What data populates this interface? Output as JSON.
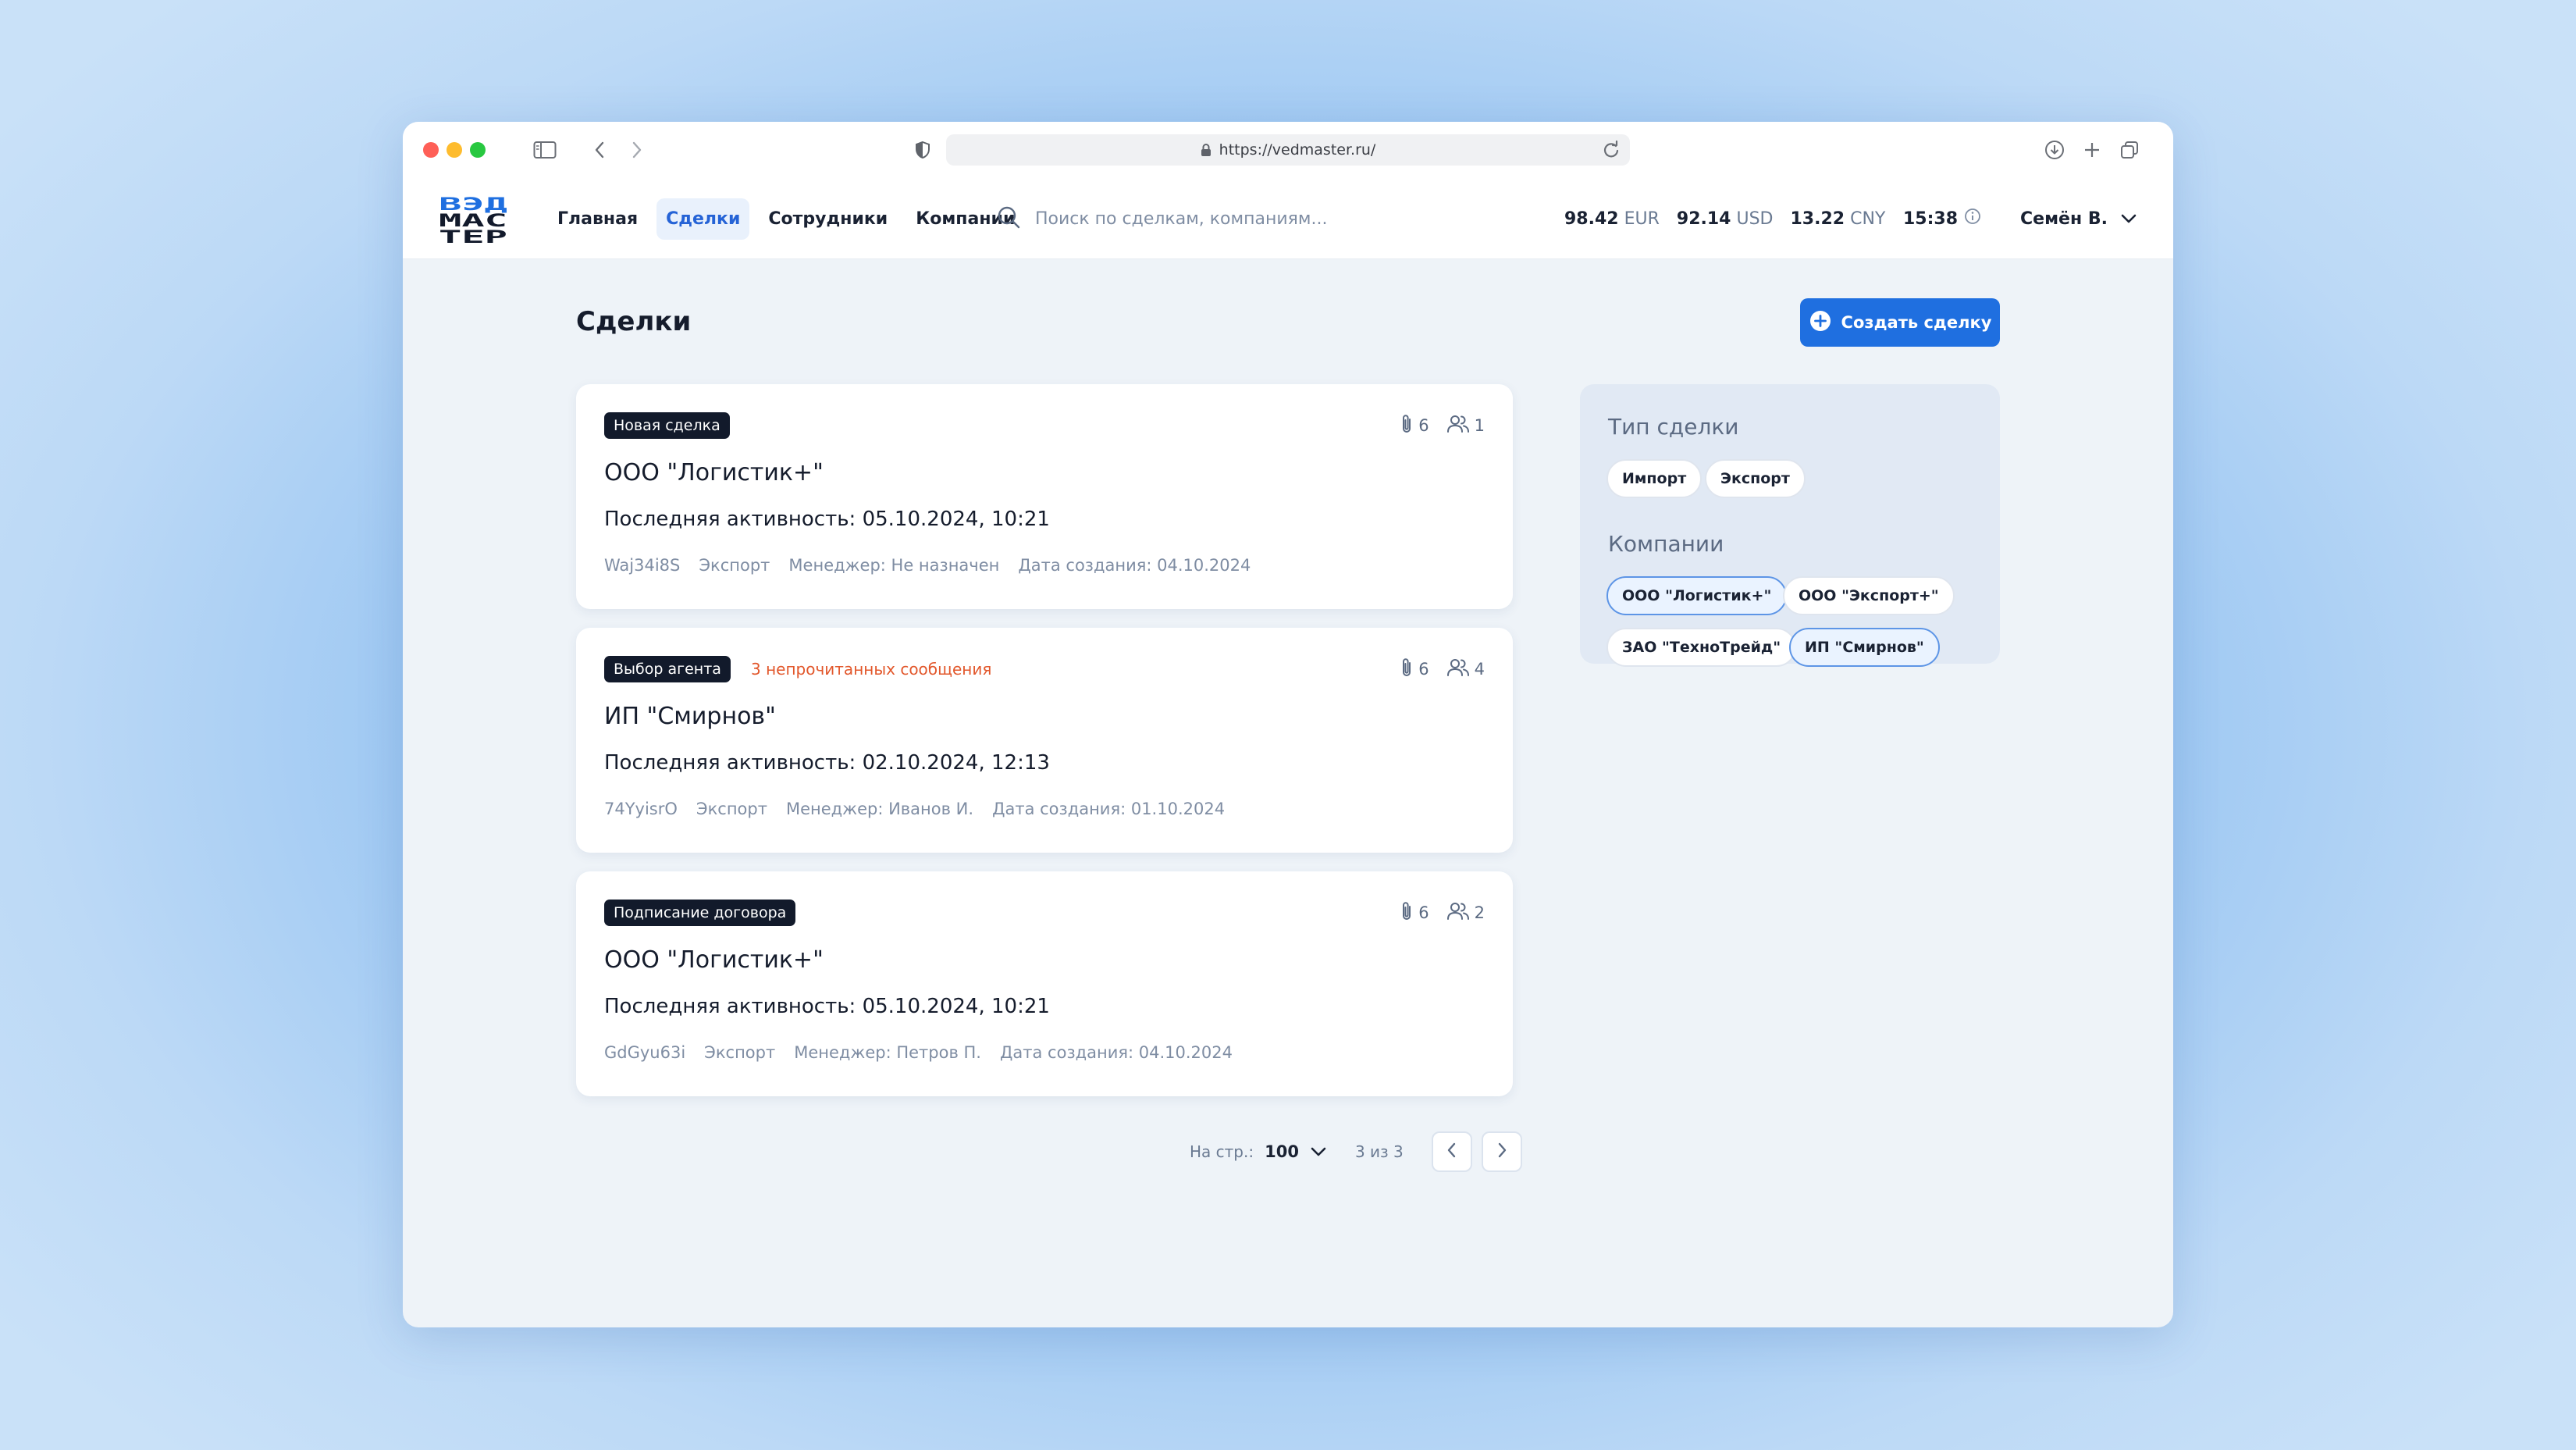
{
  "browser": {
    "url": "https://vedmaster.ru/"
  },
  "header": {
    "logo_text": [
      "ВЭД",
      "МАС",
      "ТЕР"
    ],
    "nav": [
      {
        "label": "Главная",
        "active": false
      },
      {
        "label": "Сделки",
        "active": true
      },
      {
        "label": "Сотрудники",
        "active": false
      },
      {
        "label": "Компании",
        "active": false
      }
    ],
    "search_placeholder": "Поиск по сделкам, компаниям...",
    "rates": [
      {
        "value": "98.42",
        "currency": "EUR"
      },
      {
        "value": "92.14",
        "currency": "USD"
      },
      {
        "value": "13.22",
        "currency": "CNY"
      }
    ],
    "time": "15:38",
    "user": "Семён В."
  },
  "page": {
    "title": "Сделки",
    "create_button": "Создать сделку"
  },
  "deals": [
    {
      "status": "Новая сделка",
      "unread": "",
      "files": "6",
      "members": "1",
      "company": "ООО \"Логистик+\"",
      "activity": "Последняя активность: 05.10.2024, 10:21",
      "id": "Waj34i8S",
      "type": "Экспорт",
      "manager": "Менеджер: Не назначен",
      "created": "Дата создания: 04.10.2024"
    },
    {
      "status": "Выбор агента",
      "unread": "3 непрочитанных сообщения",
      "files": "6",
      "members": "4",
      "company": "ИП \"Смирнов\"",
      "activity": "Последняя активность: 02.10.2024, 12:13",
      "id": "74YyisrO",
      "type": "Экспорт",
      "manager": "Менеджер: Иванов И.",
      "created": "Дата создания: 01.10.2024"
    },
    {
      "status": "Подписание договора",
      "unread": "",
      "files": "6",
      "members": "2",
      "company": "ООО \"Логистик+\"",
      "activity": "Последняя активность: 05.10.2024, 10:21",
      "id": "GdGyu63i",
      "type": "Экспорт",
      "manager": "Менеджер: Петров П.",
      "created": "Дата создания: 04.10.2024"
    }
  ],
  "pagination": {
    "per_page_label": "На стр.:",
    "per_page": "100",
    "info": "3 из 3"
  },
  "filters": {
    "type_title": "Тип сделки",
    "types": [
      {
        "label": "Импорт",
        "selected": false
      },
      {
        "label": "Экспорт",
        "selected": false
      }
    ],
    "companies_title": "Компании",
    "companies": [
      {
        "label": "ООО \"Логистик+\"",
        "selected": true
      },
      {
        "label": "ООО \"Экспорт+\"",
        "selected": false
      },
      {
        "label": "ЗАО \"ТехноТрейд\"",
        "selected": false
      },
      {
        "label": "ИП \"Смирнов\"",
        "selected": true
      }
    ]
  },
  "colors": {
    "accent": "#1f6fe0",
    "unread": "#e2572b",
    "badge": "#121a2b"
  }
}
